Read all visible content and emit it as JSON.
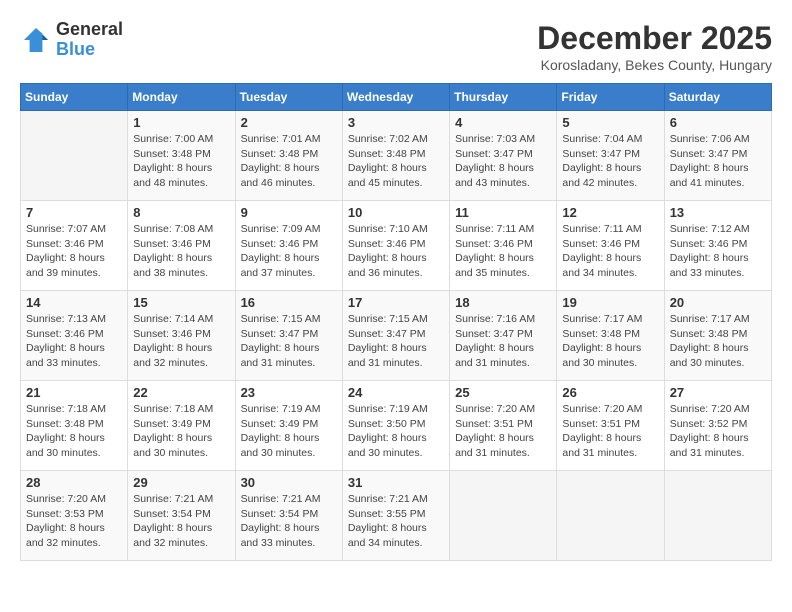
{
  "header": {
    "logo_general": "General",
    "logo_blue": "Blue",
    "month_title": "December 2025",
    "location": "Korosladany, Bekes County, Hungary"
  },
  "weekdays": [
    "Sunday",
    "Monday",
    "Tuesday",
    "Wednesday",
    "Thursday",
    "Friday",
    "Saturday"
  ],
  "weeks": [
    [
      {
        "day": "",
        "sunrise": "",
        "sunset": "",
        "daylight": "",
        "empty": true
      },
      {
        "day": "1",
        "sunrise": "Sunrise: 7:00 AM",
        "sunset": "Sunset: 3:48 PM",
        "daylight": "Daylight: 8 hours and 48 minutes."
      },
      {
        "day": "2",
        "sunrise": "Sunrise: 7:01 AM",
        "sunset": "Sunset: 3:48 PM",
        "daylight": "Daylight: 8 hours and 46 minutes."
      },
      {
        "day": "3",
        "sunrise": "Sunrise: 7:02 AM",
        "sunset": "Sunset: 3:48 PM",
        "daylight": "Daylight: 8 hours and 45 minutes."
      },
      {
        "day": "4",
        "sunrise": "Sunrise: 7:03 AM",
        "sunset": "Sunset: 3:47 PM",
        "daylight": "Daylight: 8 hours and 43 minutes."
      },
      {
        "day": "5",
        "sunrise": "Sunrise: 7:04 AM",
        "sunset": "Sunset: 3:47 PM",
        "daylight": "Daylight: 8 hours and 42 minutes."
      },
      {
        "day": "6",
        "sunrise": "Sunrise: 7:06 AM",
        "sunset": "Sunset: 3:47 PM",
        "daylight": "Daylight: 8 hours and 41 minutes."
      }
    ],
    [
      {
        "day": "7",
        "sunrise": "Sunrise: 7:07 AM",
        "sunset": "Sunset: 3:46 PM",
        "daylight": "Daylight: 8 hours and 39 minutes."
      },
      {
        "day": "8",
        "sunrise": "Sunrise: 7:08 AM",
        "sunset": "Sunset: 3:46 PM",
        "daylight": "Daylight: 8 hours and 38 minutes."
      },
      {
        "day": "9",
        "sunrise": "Sunrise: 7:09 AM",
        "sunset": "Sunset: 3:46 PM",
        "daylight": "Daylight: 8 hours and 37 minutes."
      },
      {
        "day": "10",
        "sunrise": "Sunrise: 7:10 AM",
        "sunset": "Sunset: 3:46 PM",
        "daylight": "Daylight: 8 hours and 36 minutes."
      },
      {
        "day": "11",
        "sunrise": "Sunrise: 7:11 AM",
        "sunset": "Sunset: 3:46 PM",
        "daylight": "Daylight: 8 hours and 35 minutes."
      },
      {
        "day": "12",
        "sunrise": "Sunrise: 7:11 AM",
        "sunset": "Sunset: 3:46 PM",
        "daylight": "Daylight: 8 hours and 34 minutes."
      },
      {
        "day": "13",
        "sunrise": "Sunrise: 7:12 AM",
        "sunset": "Sunset: 3:46 PM",
        "daylight": "Daylight: 8 hours and 33 minutes."
      }
    ],
    [
      {
        "day": "14",
        "sunrise": "Sunrise: 7:13 AM",
        "sunset": "Sunset: 3:46 PM",
        "daylight": "Daylight: 8 hours and 33 minutes."
      },
      {
        "day": "15",
        "sunrise": "Sunrise: 7:14 AM",
        "sunset": "Sunset: 3:46 PM",
        "daylight": "Daylight: 8 hours and 32 minutes."
      },
      {
        "day": "16",
        "sunrise": "Sunrise: 7:15 AM",
        "sunset": "Sunset: 3:47 PM",
        "daylight": "Daylight: 8 hours and 31 minutes."
      },
      {
        "day": "17",
        "sunrise": "Sunrise: 7:15 AM",
        "sunset": "Sunset: 3:47 PM",
        "daylight": "Daylight: 8 hours and 31 minutes."
      },
      {
        "day": "18",
        "sunrise": "Sunrise: 7:16 AM",
        "sunset": "Sunset: 3:47 PM",
        "daylight": "Daylight: 8 hours and 31 minutes."
      },
      {
        "day": "19",
        "sunrise": "Sunrise: 7:17 AM",
        "sunset": "Sunset: 3:48 PM",
        "daylight": "Daylight: 8 hours and 30 minutes."
      },
      {
        "day": "20",
        "sunrise": "Sunrise: 7:17 AM",
        "sunset": "Sunset: 3:48 PM",
        "daylight": "Daylight: 8 hours and 30 minutes."
      }
    ],
    [
      {
        "day": "21",
        "sunrise": "Sunrise: 7:18 AM",
        "sunset": "Sunset: 3:48 PM",
        "daylight": "Daylight: 8 hours and 30 minutes."
      },
      {
        "day": "22",
        "sunrise": "Sunrise: 7:18 AM",
        "sunset": "Sunset: 3:49 PM",
        "daylight": "Daylight: 8 hours and 30 minutes."
      },
      {
        "day": "23",
        "sunrise": "Sunrise: 7:19 AM",
        "sunset": "Sunset: 3:49 PM",
        "daylight": "Daylight: 8 hours and 30 minutes."
      },
      {
        "day": "24",
        "sunrise": "Sunrise: 7:19 AM",
        "sunset": "Sunset: 3:50 PM",
        "daylight": "Daylight: 8 hours and 30 minutes."
      },
      {
        "day": "25",
        "sunrise": "Sunrise: 7:20 AM",
        "sunset": "Sunset: 3:51 PM",
        "daylight": "Daylight: 8 hours and 31 minutes."
      },
      {
        "day": "26",
        "sunrise": "Sunrise: 7:20 AM",
        "sunset": "Sunset: 3:51 PM",
        "daylight": "Daylight: 8 hours and 31 minutes."
      },
      {
        "day": "27",
        "sunrise": "Sunrise: 7:20 AM",
        "sunset": "Sunset: 3:52 PM",
        "daylight": "Daylight: 8 hours and 31 minutes."
      }
    ],
    [
      {
        "day": "28",
        "sunrise": "Sunrise: 7:20 AM",
        "sunset": "Sunset: 3:53 PM",
        "daylight": "Daylight: 8 hours and 32 minutes."
      },
      {
        "day": "29",
        "sunrise": "Sunrise: 7:21 AM",
        "sunset": "Sunset: 3:54 PM",
        "daylight": "Daylight: 8 hours and 32 minutes."
      },
      {
        "day": "30",
        "sunrise": "Sunrise: 7:21 AM",
        "sunset": "Sunset: 3:54 PM",
        "daylight": "Daylight: 8 hours and 33 minutes."
      },
      {
        "day": "31",
        "sunrise": "Sunrise: 7:21 AM",
        "sunset": "Sunset: 3:55 PM",
        "daylight": "Daylight: 8 hours and 34 minutes."
      },
      {
        "day": "",
        "sunrise": "",
        "sunset": "",
        "daylight": "",
        "empty": true
      },
      {
        "day": "",
        "sunrise": "",
        "sunset": "",
        "daylight": "",
        "empty": true
      },
      {
        "day": "",
        "sunrise": "",
        "sunset": "",
        "daylight": "",
        "empty": true
      }
    ]
  ]
}
